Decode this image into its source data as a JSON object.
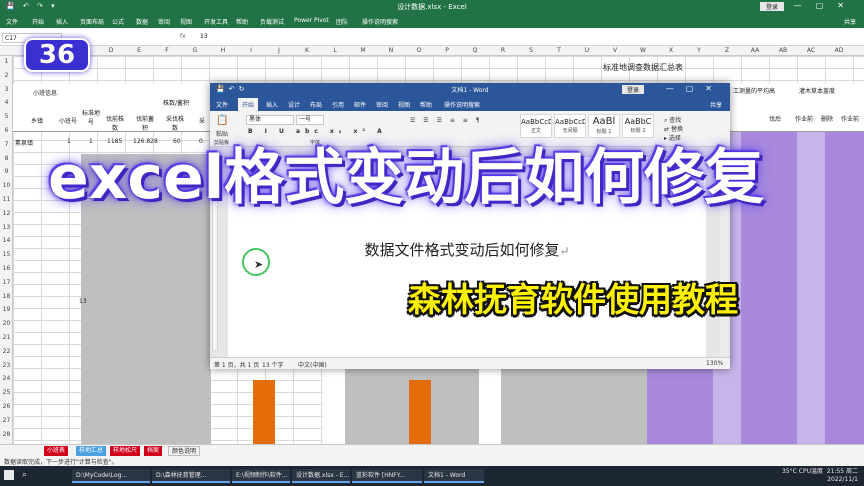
{
  "excel": {
    "title": "设计数据.xlsx  -  Excel",
    "quick_access": "💾 ↶ ↷ ▾",
    "login": "登录",
    "share": "共享",
    "tabs": [
      "文件",
      "开始",
      "插入",
      "页面布局",
      "公式",
      "数据",
      "审阅",
      "视图",
      "开发工具",
      "帮助",
      "负载测试",
      "Power Pivot",
      "团队",
      "操作说明搜索"
    ],
    "name_box": "C17",
    "fx": "fx",
    "formula_value": "13",
    "columns": [
      "A",
      "B",
      "C",
      "D",
      "E",
      "F",
      "G",
      "H",
      "I",
      "J",
      "K",
      "L",
      "M",
      "N",
      "O",
      "P",
      "Q",
      "R",
      "S",
      "T",
      "U",
      "V",
      "W",
      "X",
      "Y",
      "Z",
      "AA",
      "AB",
      "AC",
      "AD"
    ],
    "rows": [
      "1",
      "2",
      "3",
      "4",
      "5",
      "6",
      "7",
      "8",
      "9",
      "10",
      "11",
      "12",
      "13",
      "14",
      "15",
      "16",
      "17",
      "18",
      "19",
      "20",
      "21",
      "22",
      "23",
      "24",
      "25",
      "26",
      "27",
      "28"
    ],
    "sheet_title": "标准地调查数据汇总表",
    "header_cells": {
      "group_info": "小班信息",
      "township": "乡镇",
      "sub_no": "小班号",
      "plot_no": "标准地号",
      "before_trees": "伐前株数",
      "before_volume": "伐前蓄积",
      "cut_trees": "采伐株数",
      "cut_short": "采",
      "stock": "株数/蓄积",
      "right_avg": "工测量的平均高",
      "shrub": "灌木草本盖度",
      "after": "伐后",
      "operation": "作业前",
      "delete": "删除",
      "operation2": "作业前"
    },
    "row6": {
      "township": "素泉镇",
      "sub_no": "1",
      "plot_no": "1",
      "trees": "1185",
      "volume": "126.828",
      "cut": "60",
      "extra": "0."
    },
    "row17_value": "13",
    "sheet_tabs": [
      "小班表",
      "样地汇总",
      "样地松尺",
      "档案",
      "颜色说明"
    ],
    "status": "数据读取完成，下一步进行\"计算与检查\"。",
    "accent": "#217346"
  },
  "word": {
    "title": "文档1  -  Word",
    "login": "登录",
    "share": "共享",
    "tabs": [
      "文件",
      "开始",
      "插入",
      "设计",
      "布局",
      "引用",
      "邮件",
      "审阅",
      "视图",
      "帮助",
      "操作说明搜索"
    ],
    "font_name": "黑体",
    "font_size": "一号",
    "paste": "粘贴",
    "clipboard": "剪贴板",
    "font_group": "字体",
    "styles": [
      {
        "sample": "AaBbCcDi",
        "name": "正文"
      },
      {
        "sample": "AaBbCcDi",
        "name": "无间隔"
      },
      {
        "sample": "AaBl",
        "name": "标题 1"
      },
      {
        "sample": "AaBbC",
        "name": "标题 2"
      }
    ],
    "find": "查找",
    "replace": "替换",
    "select": "选择",
    "document_text": "数据文件格式变动后如何修复",
    "status_page": "第 1 页，共 1 页",
    "status_words": "13 个字",
    "status_lang": "中文(中国)",
    "zoom": "130%",
    "accent": "#2b579a"
  },
  "overlay": {
    "episode": "36",
    "headline": "excel格式变动后如何修复",
    "subline": "森林抚育软件使用教程"
  },
  "taskbar": {
    "items": [
      "D:\\MyCode\\Log...",
      "D:\\森林抚育管理...",
      "E:\\视频制作\\软件...",
      "设计数据.xlsx - E...",
      "蓝彩软件 [HNFY...",
      "文档1 - Word"
    ],
    "weather": "35°C",
    "cpu": "CPU温度",
    "time": "21:55 周二",
    "date": "2022/11/1"
  }
}
